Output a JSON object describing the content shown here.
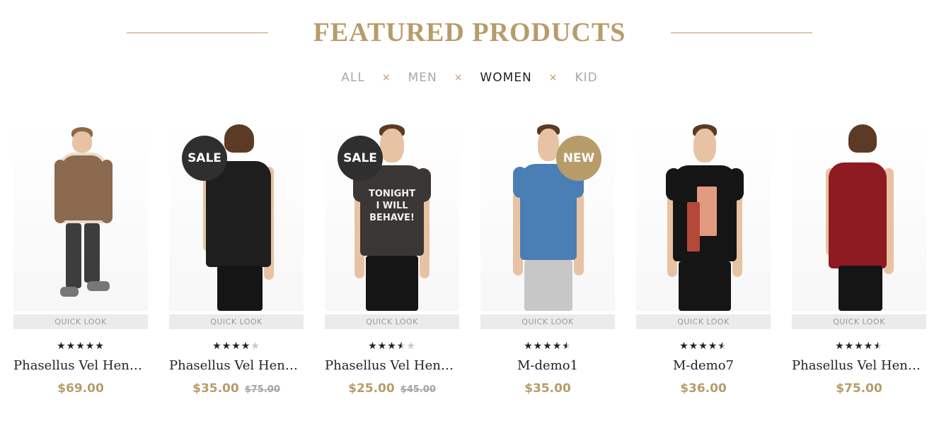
{
  "section_title": "FEATURED PRODUCTS",
  "tabs": [
    {
      "label": "ALL"
    },
    {
      "label": "MEN"
    },
    {
      "label": "WOMEN"
    },
    {
      "label": "KID"
    }
  ],
  "tab_separator": "×",
  "active_tab": "WOMEN",
  "colors": {
    "accent": "#b79c6a",
    "sale_badge": "#2f2f2f",
    "new_badge": "#b79c6a"
  },
  "products": [
    {
      "name": "Phasellus Vel Hend...",
      "price": "$69.00",
      "old_price": "",
      "badge": "",
      "rating": 5,
      "quick_look": "QUICK LOOK"
    },
    {
      "name": "Phasellus Vel Hend...",
      "price": "$35.00",
      "old_price": "$75.00",
      "badge": "SALE",
      "rating": 4,
      "quick_look": "QUICK LOOK"
    },
    {
      "name": "Phasellus Vel Hend...",
      "price": "$25.00",
      "old_price": "$45.00",
      "badge": "SALE",
      "rating": 3.5,
      "quick_look": "QUICK LOOK"
    },
    {
      "name": "M-demo1",
      "price": "$35.00",
      "old_price": "",
      "badge": "NEW",
      "rating": 4.5,
      "quick_look": "QUICK LOOK"
    },
    {
      "name": "M-demo7",
      "price": "$36.00",
      "old_price": "",
      "badge": "",
      "rating": 4.5,
      "quick_look": "QUICK LOOK"
    },
    {
      "name": "Phasellus Vel Hend...",
      "price": "$75.00",
      "old_price": "",
      "badge": "",
      "rating": 4.5,
      "quick_look": "QUICK LOOK"
    }
  ],
  "shirt_prints": {
    "p3": [
      "TONIGHT",
      "I WILL",
      "BEHAVE!"
    ]
  }
}
